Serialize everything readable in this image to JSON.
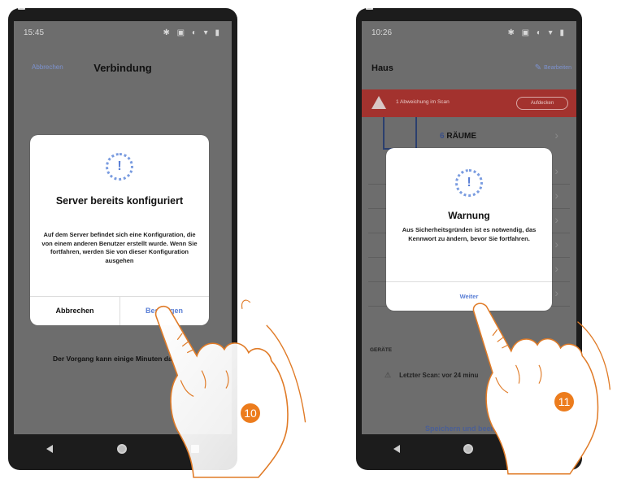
{
  "left_phone": {
    "status_time": "15:45",
    "header": {
      "cancel": "Abbrechen",
      "title": "Verbindung"
    },
    "dialog": {
      "icon": "warning-dotted-circle-icon",
      "title": "Server bereits konfiguriert",
      "body": "Auf dem Server befindet sich eine Konfiguration, die von einem anderen Benutzer erstellt wurde. Wenn Sie fortfahren, werden Sie von dieser Konfiguration ausgehen",
      "cancel_label": "Abbrechen",
      "confirm_label": "Bestätigen"
    },
    "bottom_text": "Der Vorgang kann einige Minuten da",
    "step_number": "10"
  },
  "right_phone": {
    "status_time": "10:26",
    "header": {
      "title": "Haus",
      "edit": "Bearbeiten"
    },
    "alert": {
      "text": "1 Abweichung im Scan",
      "button": "Aufdecken"
    },
    "rooms": {
      "count": "6",
      "label": "RÄUME"
    },
    "dialog": {
      "icon": "warning-dotted-circle-icon",
      "title": "Warnung",
      "body": "Aus Sicherheitsgründen ist es notwendig, das Kennwort zu ändern, bevor Sie fortfahren.",
      "continue_label": "Weiter"
    },
    "section_label": "GERÄTE",
    "last_scan": "Letzter Scan: vor 24 minu",
    "save_label": "Speichern und beend",
    "step_number": "11"
  },
  "colors": {
    "accent_blue": "#5a7fd6",
    "badge_orange": "#ec7c1d",
    "alert_red": "#a3322e"
  }
}
